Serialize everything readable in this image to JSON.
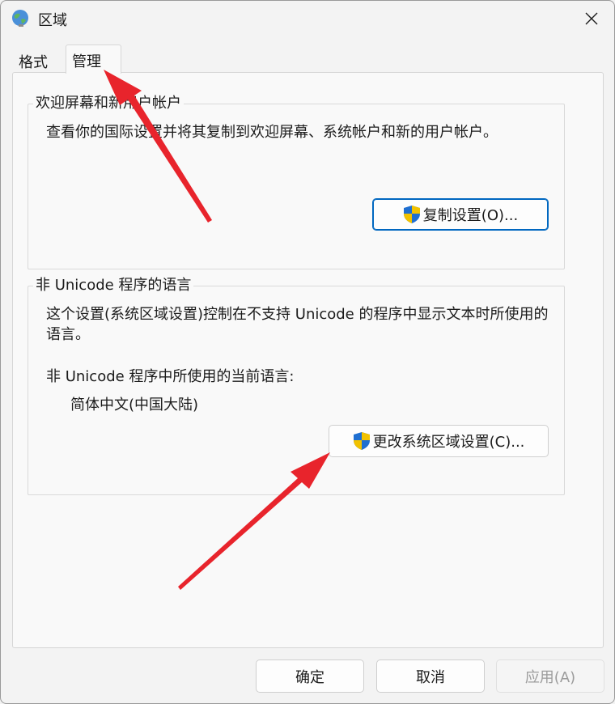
{
  "window": {
    "title": "区域",
    "icon": "globe-icon"
  },
  "tabs": [
    {
      "label": "格式",
      "selected": false
    },
    {
      "label": "管理",
      "selected": true
    }
  ],
  "welcome_group": {
    "label": "欢迎屏幕和新用户帐户",
    "description": "查看你的国际设置并将其复制到欢迎屏幕、系统帐户和新的用户帐户。",
    "button_label": "复制设置(O)..."
  },
  "unicode_group": {
    "label": "非 Unicode 程序的语言",
    "description_line1": "这个设置(系统区域设置)控制在不支持 Unicode 的程序中显示文本时所使用的",
    "description_line2": "语言。",
    "current_label": "非 Unicode 程序中所使用的当前语言:",
    "current_value": "简体中文(中国大陆)",
    "button_label": "更改系统区域设置(C)..."
  },
  "footer": {
    "ok_label": "确定",
    "cancel_label": "取消",
    "apply_label": "应用(A)"
  },
  "colors": {
    "arrow": "#e8242c",
    "accent": "#0067c0",
    "shield_blue": "#1f6fd1",
    "shield_yellow": "#f2c200"
  }
}
